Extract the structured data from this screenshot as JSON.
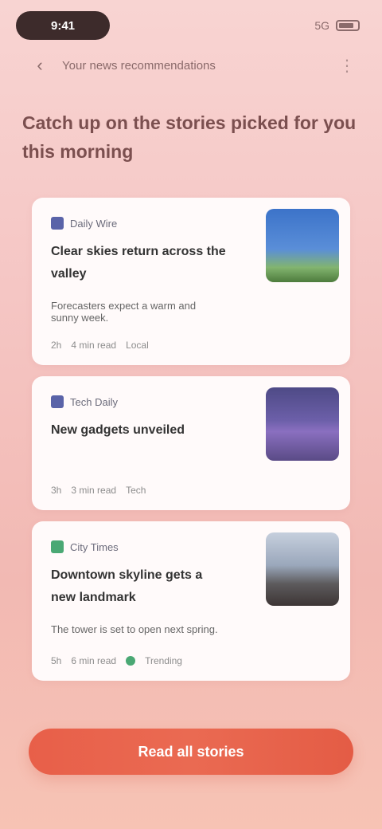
{
  "status_bar": {
    "time": "9:41",
    "network": "5G"
  },
  "header": {
    "title": "Your news recommendations"
  },
  "headline": "Catch up on the stories picked for you this morning",
  "cards": [
    {
      "source": "Daily Wire",
      "title": "Clear skies return across the valley",
      "desc": "Forecasters expect a warm and sunny week.",
      "meta": [
        "2h",
        "4 min read",
        "Local"
      ]
    },
    {
      "source": "Tech Daily",
      "title": "New gadgets unveiled",
      "desc": "",
      "meta": [
        "3h",
        "3 min read",
        "Tech"
      ]
    },
    {
      "source": "City Times",
      "title": "Downtown skyline gets a new landmark",
      "desc": "The tower is set to open next spring.",
      "meta": [
        "5h",
        "6 min read",
        "Trending"
      ]
    }
  ],
  "action_button": "Read all stories"
}
